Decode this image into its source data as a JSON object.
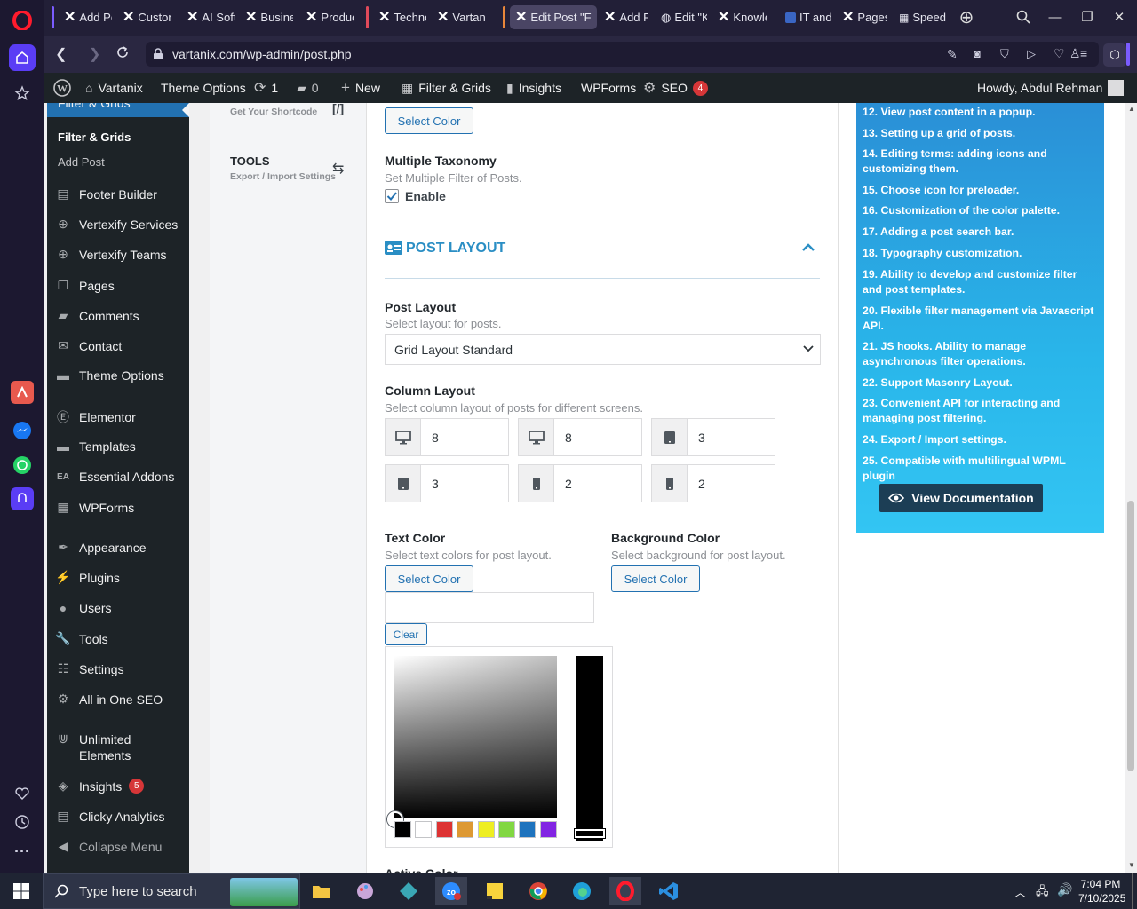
{
  "browser": {
    "tabs": [
      {
        "label": "Add Pc",
        "active": false
      },
      {
        "label": "Custon",
        "active": false
      },
      {
        "label": "AI Soft",
        "active": false
      },
      {
        "label": "Busine",
        "active": false
      },
      {
        "label": "Produc",
        "active": false
      },
      {
        "label": "Techno",
        "active": false
      },
      {
        "label": "Vartani",
        "active": false
      },
      {
        "label": "Edit Post \"Fil",
        "active": true
      },
      {
        "label": "Add Pc",
        "active": false
      },
      {
        "label": "Edit \"K",
        "active": false
      },
      {
        "label": "Knowle",
        "active": false
      },
      {
        "label": "IT and",
        "active": false
      },
      {
        "label": "Pages",
        "active": false
      },
      {
        "label": "Speed",
        "active": false
      }
    ],
    "url": "vartanix.com/wp-admin/post.php"
  },
  "adminbar": {
    "site": "Vartanix",
    "theme_options": "Theme Options",
    "updates": "1",
    "comments": "0",
    "new": "New",
    "filter_grids": "Filter & Grids",
    "insights": "Insights",
    "wpforms": "WPForms",
    "seo": "SEO",
    "seo_count": "4",
    "howdy": "Howdy, Abdul Rehman"
  },
  "menu": {
    "current": "Filter & Grids",
    "submenu": [
      "Filter & Grids",
      "Add Post"
    ],
    "items": [
      "Footer Builder",
      "Vertexify Services",
      "Vertexify Teams",
      "Pages",
      "Comments",
      "Contact",
      "Theme Options",
      "Elementor",
      "Templates",
      "Essential Addons",
      "WPForms",
      "Appearance",
      "Plugins",
      "Users",
      "Tools",
      "Settings",
      "All in One SEO",
      "Unlimited Elements",
      "Insights",
      "Clicky Analytics",
      "Collapse Menu"
    ],
    "insights_count": "5"
  },
  "settings_nav": {
    "shortcode_sub": "Get Your Shortcode",
    "tools_title": "TOOLS",
    "tools_sub": "Export / Import Settings"
  },
  "main": {
    "top_select_color": "Select Color",
    "multi_tax_label": "Multiple Taxonomy",
    "multi_tax_desc": "Set Multiple Filter of Posts.",
    "enable_label": "Enable",
    "section_title": "POST LAYOUT",
    "post_layout_label": "Post Layout",
    "post_layout_desc": "Select layout for posts.",
    "post_layout_value": "Grid Layout Standard",
    "column_layout_label": "Column Layout",
    "column_layout_desc": "Select column layout of posts for different screens.",
    "columns": [
      "8",
      "8",
      "3",
      "3",
      "2",
      "2"
    ],
    "text_color_label": "Text Color",
    "text_color_desc": "Select text colors for post layout.",
    "bg_color_label": "Background Color",
    "bg_color_desc": "Select background for post layout.",
    "select_color": "Select Color",
    "clear": "Clear",
    "palette": [
      "#000000",
      "#ffffff",
      "#dd3333",
      "#dd9933",
      "#eeee22",
      "#81d742",
      "#1e73be",
      "#8224e3"
    ],
    "partial_label": "Active Color"
  },
  "features": [
    "12. View post content in a popup.",
    "13. Setting up a grid of posts.",
    "14. Editing terms: adding icons and customizing them.",
    "15. Choose icon for preloader.",
    "16. Customization of the color palette.",
    "17. Adding a post search bar.",
    "18. Typography customization.",
    "19. Ability to develop and customize filter and post templates.",
    "20. Flexible filter management via Javascript API.",
    "21. JS hooks. Ability to manage asynchronous filter operations.",
    "22. Support Masonry Layout.",
    "23. Convenient API for interacting and managing post filtering.",
    "24. Export / Import settings.",
    "25. Compatible with multilingual WPML plugin"
  ],
  "view_docs": "View Documentation",
  "taskbar": {
    "search_placeholder": "Type here to search",
    "time": "7:04 PM",
    "date": "7/10/2025"
  }
}
